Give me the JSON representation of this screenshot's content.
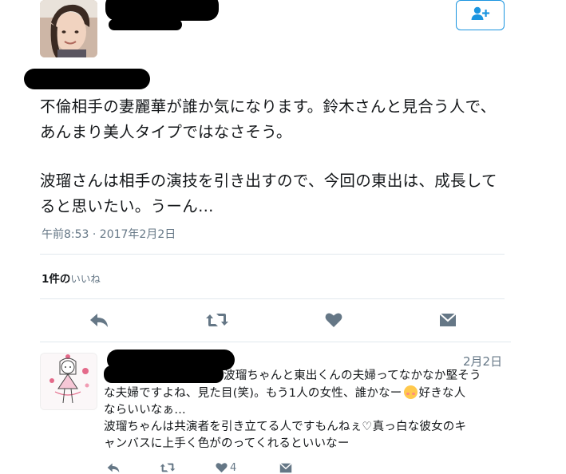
{
  "tweet": {
    "text_line1": "不倫相手の妻麗華が誰か気になります。鈴木さんと見合う人で、",
    "text_line2": "あんまり美人タイプではなさそう。",
    "text_line3": "波瑠さんは相手の演技を引き出すので、今回の東出は、成長して",
    "text_line4": "ると思いたい。うーん…",
    "timestamp": "午前8:53 · 2017年2月2日",
    "likes_count": "1件の",
    "likes_label": "いいね"
  },
  "reply": {
    "date": "2月2日",
    "line1": "波瑠ちゃんと東出くんの夫婦ってなかなか堅そう",
    "line2a": "な夫婦ですよね、見た目(笑)。もう1人の女性、誰かなー",
    "line2b": "好きな人",
    "line3": "ならいいなぁ…",
    "line4": "波瑠ちゃんは共演者を引き立てる人ですもんねぇ♡真っ白な彼女のキ",
    "line5": "ャンバスに上手く色がのってくれるといいなー",
    "like_count": "4"
  },
  "colors": {
    "accent": "#1b95e0",
    "icon_gray": "#657786",
    "divider": "#e1e8ed"
  },
  "icons": [
    "add-user-icon",
    "reply-icon",
    "retweet-icon",
    "like-icon",
    "message-icon"
  ]
}
